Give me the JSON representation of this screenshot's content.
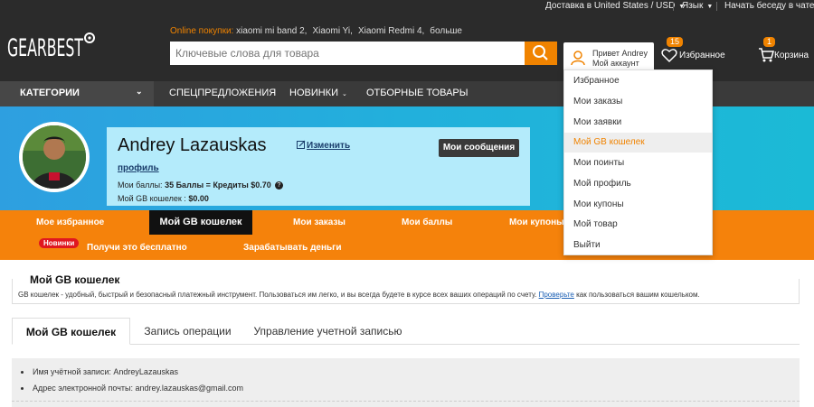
{
  "topbar": {
    "shipping": "Доставка в United States / USD",
    "language": "Язык",
    "chat": "Начать беседу в чате"
  },
  "header": {
    "hot_label": "Online покупки:",
    "hot_links": [
      "xiaomi mi band 2,",
      "Xiaomi Yi,",
      "Xiaomi Redmi 4,",
      "больше"
    ],
    "search_placeholder": "Ключевые слова для товара",
    "account_greeting": "Привет Andrey",
    "account_label": "Мой аккаунт",
    "favorites_label": "Избранное",
    "favorites_count": "15",
    "cart_label": "Корзина",
    "cart_count": "1"
  },
  "nav": {
    "categories": "КАТЕГОРИИ",
    "items": [
      "СПЕЦПРЕДЛОЖЕНИЯ",
      "НОВИНКИ",
      "ОТБОРНЫЕ ТОВАРЫ"
    ]
  },
  "profile": {
    "name": "Andrey Lazauskas",
    "edit": "Изменить",
    "messages": "Мои сообщения",
    "profile_link": "профиль",
    "points_prefix": "Мои баллы:",
    "points_value": "35 Баллы = Кредиты $0.70",
    "wallet_prefix": "Мой GB кошелек :",
    "wallet_value": "$0.00"
  },
  "account_tabs": {
    "favorites": "Мое избранное",
    "wallet": "Мой GB кошелек",
    "orders": "Мои заказы",
    "points": "Мои баллы",
    "coupons": "Мои купоны",
    "new_badge": "Новинки",
    "free": "Получи это бесплатно",
    "earn": "Зарабатывать деньги"
  },
  "dropdown": {
    "items": [
      "Избранное",
      "Мои заказы",
      "Мои заявки",
      "Мой GB кошелек",
      "Мои поинты",
      "Мой профиль",
      "Мои купоны",
      "Мой товар",
      "Выйти"
    ],
    "active_index": 3
  },
  "wallet": {
    "title": "Мой GB кошелек",
    "description": "GB кошелек - удобный, быстрый и безопасный платежный инструмент. Пользоваться им легко, и вы всегда будете в курсе всех ваших операций по счету.",
    "check_link": "Проверьте",
    "description_tail": "как пользоваться вашим кошельком."
  },
  "subtabs": [
    "Мой GB кошелек",
    "Запись операции",
    "Управление учетной записью"
  ],
  "details": {
    "account_label": "Имя учётной записи: AndreyLazauskas",
    "email_label": "Адрес электронной почты: andrey.lazauskas@gmail.com"
  },
  "colors": {
    "accent": "#f08300",
    "dark": "#2b2b2b",
    "banner": "#22b0dc"
  }
}
